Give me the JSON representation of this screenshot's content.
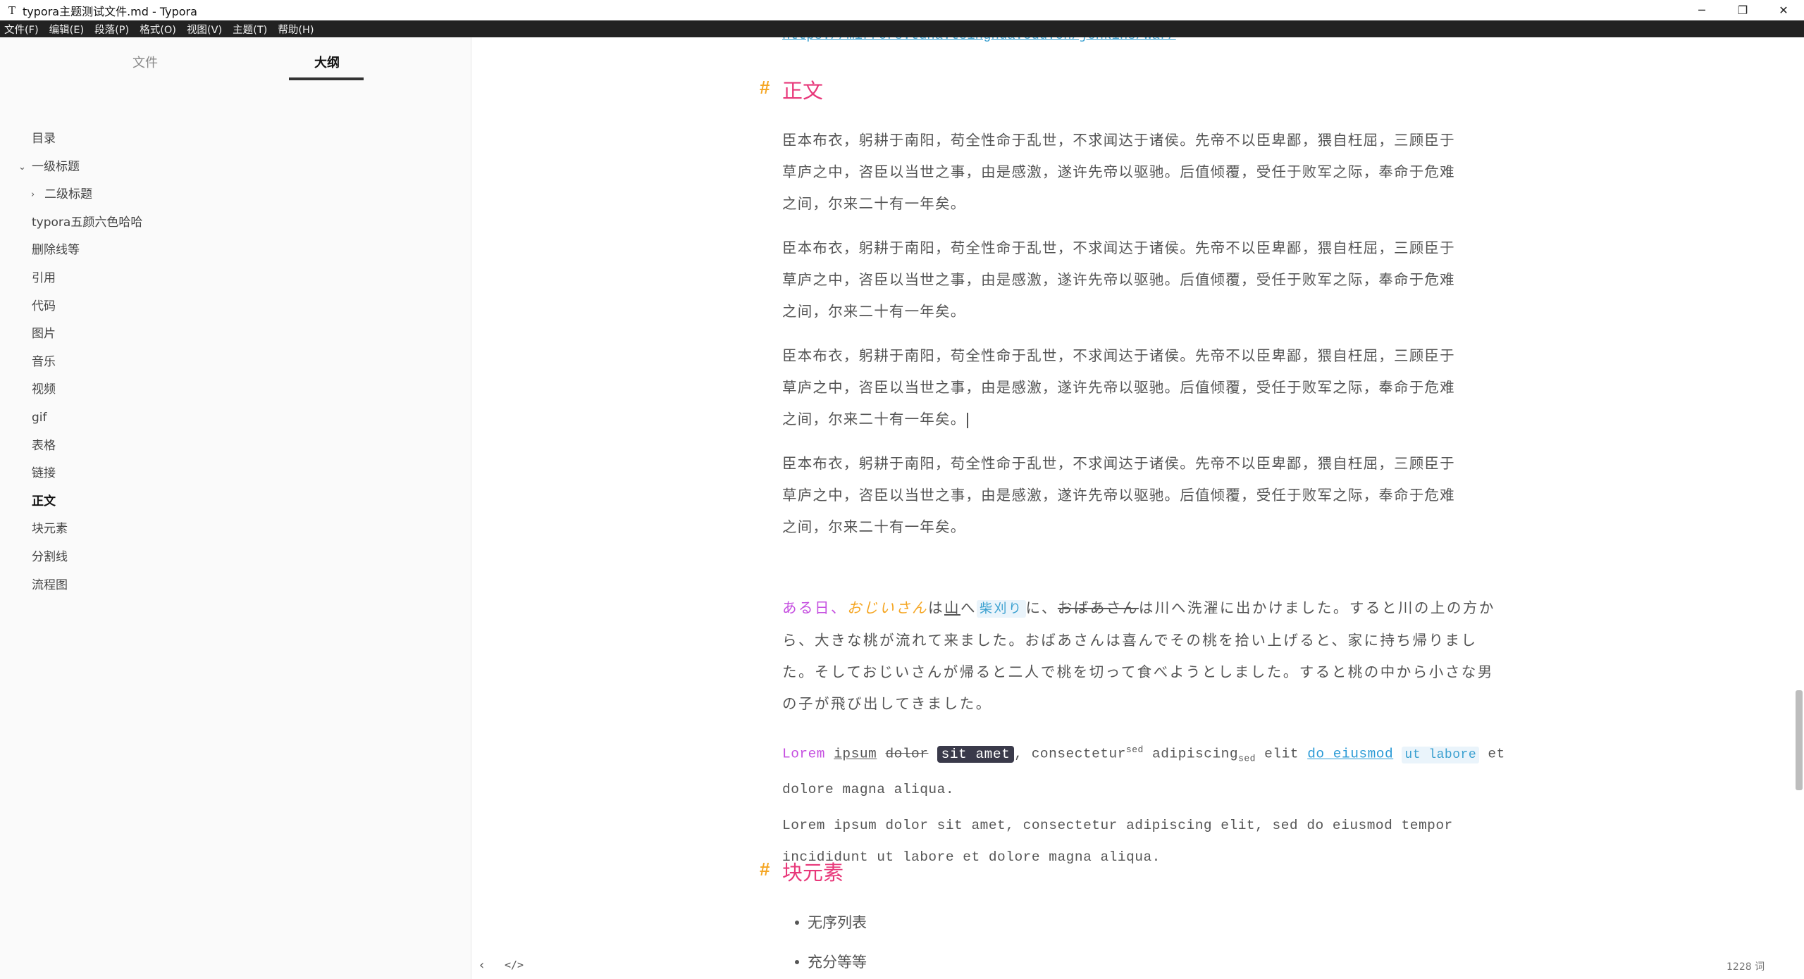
{
  "window": {
    "app_icon": "T",
    "title": "typora主题测试文件.md - Typora",
    "minimize": "─",
    "restore": "❐",
    "close": "✕"
  },
  "menu": [
    "文件(F)",
    "编辑(E)",
    "段落(P)",
    "格式(O)",
    "视图(V)",
    "主题(T)",
    "帮助(H)"
  ],
  "sidebar": {
    "tabs": {
      "files": "文件",
      "outline": "大纲"
    },
    "outline": [
      {
        "label": "目录",
        "level": 1
      },
      {
        "label": "一级标题",
        "level": 1,
        "expanded": true
      },
      {
        "label": "二级标题",
        "level": 2,
        "collapsed": true
      },
      {
        "label": "typora五颜六色哈哈",
        "level": 1
      },
      {
        "label": "删除线等",
        "level": 1
      },
      {
        "label": "引用",
        "level": 1
      },
      {
        "label": "代码",
        "level": 1
      },
      {
        "label": "图片",
        "level": 1
      },
      {
        "label": "音乐",
        "level": 1
      },
      {
        "label": "视频",
        "level": 1
      },
      {
        "label": "gif",
        "level": 1
      },
      {
        "label": "表格",
        "level": 1
      },
      {
        "label": "链接",
        "level": 1
      },
      {
        "label": "正文",
        "level": 1,
        "active": true
      },
      {
        "label": "块元素",
        "level": 1
      },
      {
        "label": "分割线",
        "level": 1
      },
      {
        "label": "流程图",
        "level": 1
      }
    ]
  },
  "editor": {
    "top_link": "https://mirrors.tuna.tsinghua.edu.cn/jenkins/war/",
    "heading_hash": "#",
    "section_main": "正文",
    "classical_lines": [
      "臣本布衣，躬耕于南阳，苟全性命于乱世，不求闻达于诸侯。先帝不以臣卑鄙，猥自枉屈，三顾臣于",
      "草庐之中，咨臣以当世之事，由是感激，遂许先帝以驱驰。后值倾覆，受任于败军之际，奉命于危难",
      "之间，尔来二十有一年矣。"
    ],
    "jp": {
      "p1": "ある日、",
      "p2": "おじいさん",
      "p3": "は",
      "p4": "山",
      "p5": "へ",
      "p6": "柴刈り",
      "p7": "に、",
      "p8": "おばあさん",
      "p9": "は川へ洗濯に出かけました。すると川の上の方か",
      "line2": "ら、大きな桃が流れて来ました。おばあさんは喜んでその桃を拾い上げると、家に持ち帰りまし",
      "line3": "た。そしておじいさんが帰ると二人で桃を切って食べようとしました。すると桃の中から小さな男",
      "line4": "の子が飛び出してきました。"
    },
    "lorem_styled": {
      "lorem": "Lorem",
      "ipsum": "ipsum",
      "dolor": "dolor",
      "sit_amet": "sit amet",
      "comma": ",",
      "consectetur": "consectetur",
      "sup": "sed",
      "adipiscing": "adipiscing",
      "sub": "sed",
      "elit": "elit",
      "do_eiusmod": "do eiusmod",
      "ut_labore": "ut labore",
      "et": "et",
      "line2": "dolore magna aliqua."
    },
    "lorem_plain": {
      "line1": "Lorem ipsum dolor sit amet, consectetur adipiscing elit, sed do eiusmod tempor",
      "line2": "incididunt ut labore et dolore magna aliqua."
    },
    "section_block": "块元素",
    "bullets": [
      "无序列表",
      "充分等等"
    ]
  },
  "footer": {
    "back": "‹",
    "code": "</>",
    "word_count": "1228 词"
  }
}
